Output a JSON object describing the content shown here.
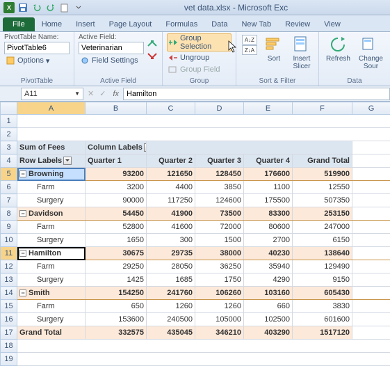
{
  "window": {
    "title": "vet data.xlsx - Microsoft Exc"
  },
  "tabs": {
    "file": "File",
    "home": "Home",
    "insert": "Insert",
    "pagelayout": "Page Layout",
    "formulas": "Formulas",
    "data": "Data",
    "newtab": "New Tab",
    "review": "Review",
    "view": "View"
  },
  "ribbon": {
    "pivottable": {
      "name_label": "PivotTable Name:",
      "name_value": "PivotTable6",
      "options": "Options",
      "group": "PivotTable"
    },
    "activefield": {
      "label": "Active Field:",
      "value": "Veterinarian",
      "settings": "Field Settings",
      "group": "Active Field"
    },
    "groupgrp": {
      "selection": "Group Selection",
      "ungroup": "Ungroup",
      "field": "Group Field",
      "group": "Group"
    },
    "sortfilter": {
      "sort": "Sort",
      "slicer": "Insert\nSlicer",
      "group": "Sort & Filter"
    },
    "data": {
      "refresh": "Refresh",
      "change": "Change\nSour",
      "group": "Data"
    }
  },
  "namebox": "A11",
  "formula": "Hamilton",
  "cols": [
    "A",
    "B",
    "C",
    "D",
    "E",
    "F",
    "G"
  ],
  "pivot": {
    "measure": "Sum of Fees",
    "collabels": "Column Labels",
    "rowlabels": "Row Labels",
    "qtrs": [
      "Quarter 1",
      "Quarter 2",
      "Quarter 3",
      "Quarter 4"
    ],
    "grandtotal_col": "Grand Total",
    "grandtotal_row": "Grand Total",
    "rows": [
      {
        "name": "Browning",
        "vals": [
          93200,
          121650,
          128450,
          176600,
          519900
        ],
        "children": [
          {
            "name": "Farm",
            "vals": [
              3200,
              4400,
              3850,
              1100,
              12550
            ]
          },
          {
            "name": "Surgery",
            "vals": [
              90000,
              117250,
              124600,
              175500,
              507350
            ]
          }
        ]
      },
      {
        "name": "Davidson",
        "vals": [
          54450,
          41900,
          73500,
          83300,
          253150
        ],
        "children": [
          {
            "name": "Farm",
            "vals": [
              52800,
              41600,
              72000,
              80600,
              247000
            ]
          },
          {
            "name": "Surgery",
            "vals": [
              1650,
              300,
              1500,
              2700,
              6150
            ]
          }
        ]
      },
      {
        "name": "Hamilton",
        "vals": [
          30675,
          29735,
          38000,
          40230,
          138640
        ],
        "children": [
          {
            "name": "Farm",
            "vals": [
              29250,
              28050,
              36250,
              35940,
              129490
            ]
          },
          {
            "name": "Surgery",
            "vals": [
              1425,
              1685,
              1750,
              4290,
              9150
            ]
          }
        ]
      },
      {
        "name": "Smith",
        "vals": [
          154250,
          241760,
          106260,
          103160,
          605430
        ],
        "children": [
          {
            "name": "Farm",
            "vals": [
              650,
              1260,
              1260,
              660,
              3830
            ]
          },
          {
            "name": "Surgery",
            "vals": [
              153600,
              240500,
              105000,
              102500,
              601600
            ]
          }
        ]
      }
    ],
    "grand": [
      332575,
      435045,
      346210,
      403290,
      1517120
    ]
  }
}
